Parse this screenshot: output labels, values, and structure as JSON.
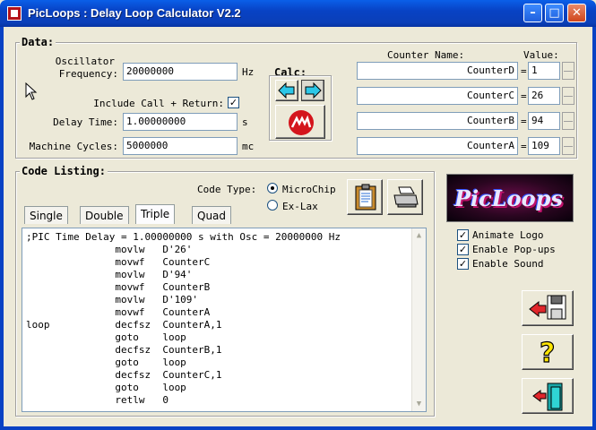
{
  "window": {
    "title": "PicLoops : Delay Loop Calculator V2.2"
  },
  "data_group": {
    "title": "Data:",
    "osc_label_1": "Oscillator",
    "osc_label_2": "Frequency:",
    "osc_value": "20000000",
    "osc_unit": "Hz",
    "include_label": "Include Call + Return:",
    "include_checked": "✓",
    "delay_label": "Delay Time:",
    "delay_value": "1.00000000",
    "delay_unit": "s",
    "cycles_label": "Machine Cycles:",
    "cycles_value": "5000000",
    "cycles_unit": "mc",
    "calc_label": "Calc:",
    "counter_name_header": "Counter Name:",
    "value_header": "Value:",
    "counters": [
      {
        "name": "CounterD",
        "value": "1"
      },
      {
        "name": "CounterC",
        "value": "26"
      },
      {
        "name": "CounterB",
        "value": "94"
      },
      {
        "name": "CounterA",
        "value": "109"
      }
    ]
  },
  "code_group": {
    "title": "Code Listing:",
    "code_type_label": "Code Type:",
    "option_microchip": "MicroChip",
    "option_exlax": "Ex-Lax",
    "tabs": [
      "Single",
      "Double",
      "Triple",
      "Quad"
    ],
    "lines": [
      ";PIC Time Delay = 1.00000000 s with Osc = 20000000 Hz",
      "               movlw   D'26'",
      "               movwf   CounterC",
      "               movlw   D'94'",
      "               movwf   CounterB",
      "               movlw   D'109'",
      "               movwf   CounterA",
      "loop           decfsz  CounterA,1",
      "               goto    loop",
      "               decfsz  CounterB,1",
      "               goto    loop",
      "               decfsz  CounterC,1",
      "               goto    loop",
      "               retlw   0"
    ]
  },
  "right_panel": {
    "logo_text": "PicLoops",
    "animate_logo": "Animate Logo",
    "enable_popups": "Enable Pop-ups",
    "enable_sound": "Enable Sound",
    "check": "✓"
  }
}
